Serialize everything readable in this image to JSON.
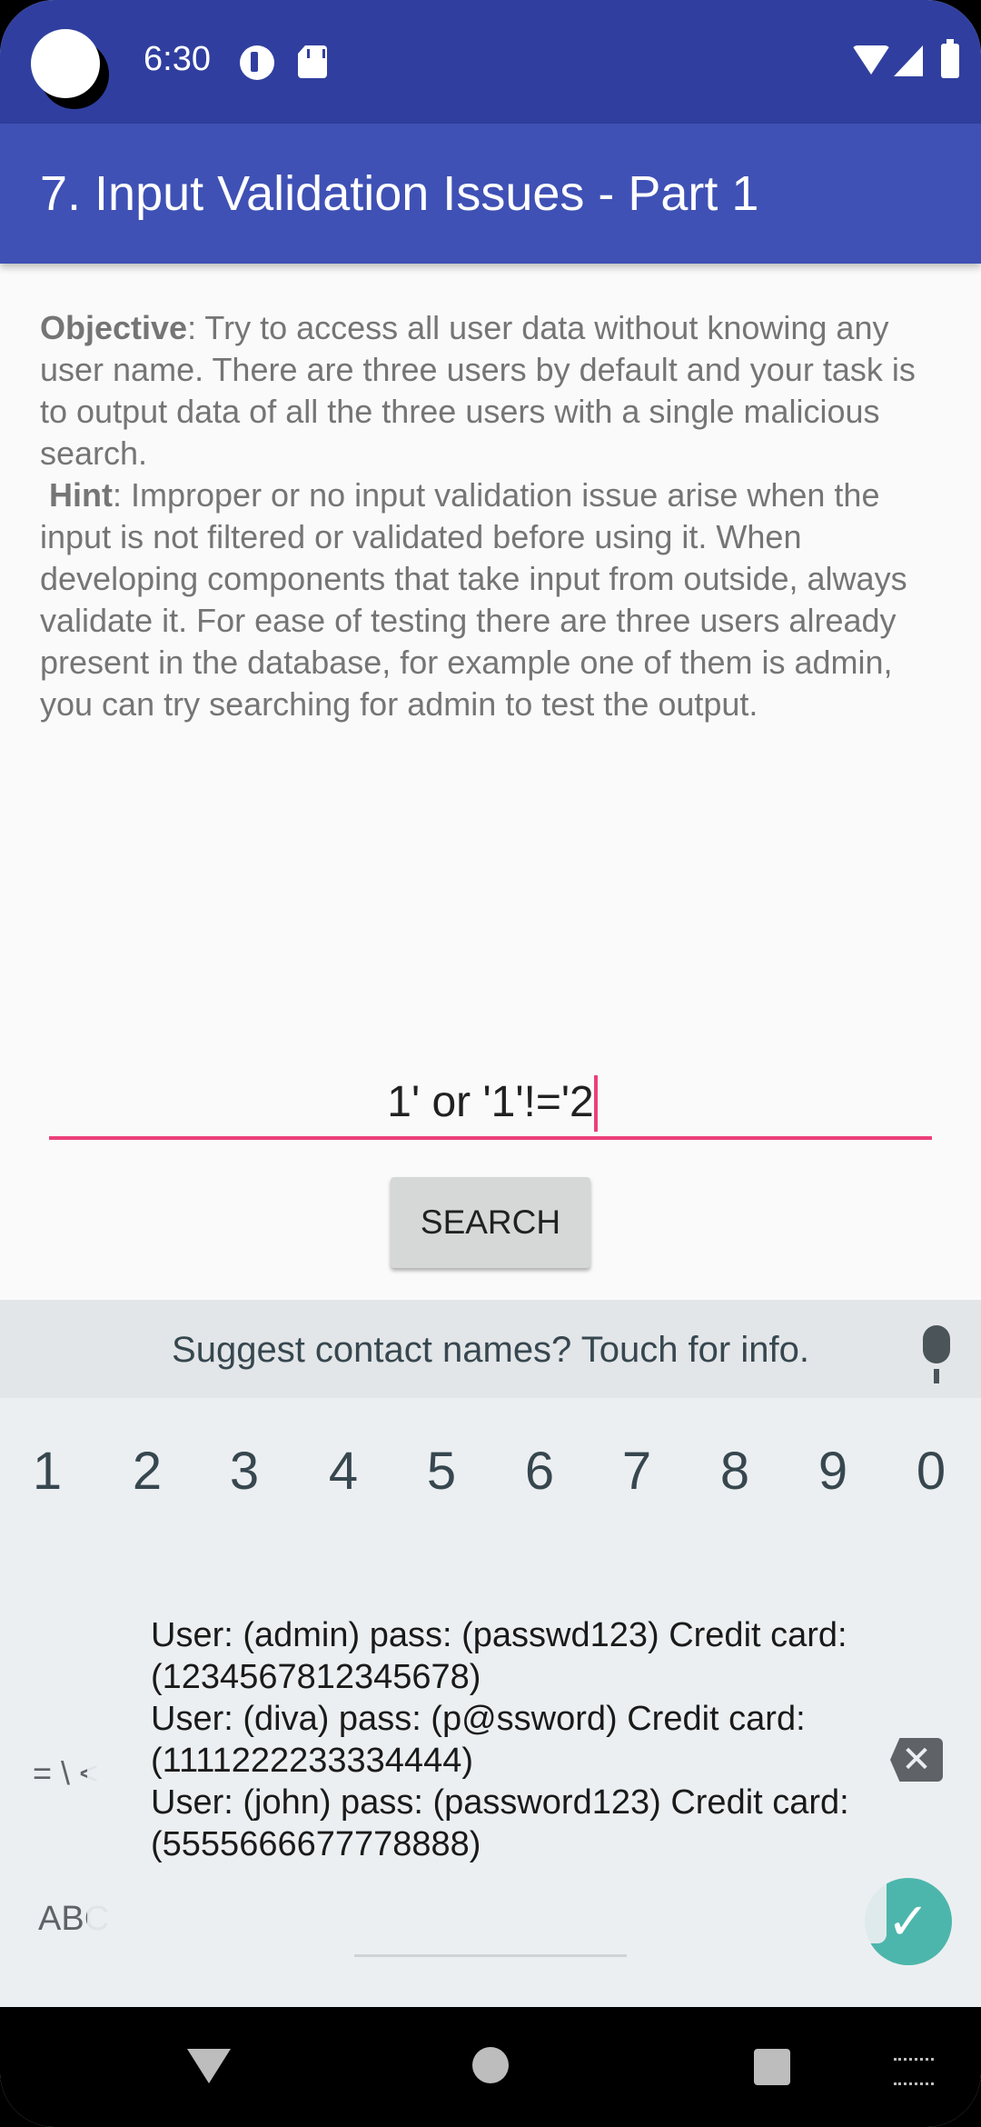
{
  "status_bar": {
    "time": "6:30"
  },
  "app_bar": {
    "title": "7. Input Validation Issues - Part 1"
  },
  "description": {
    "objective_label": "Objective",
    "objective_text": ": Try to access all user data without knowing any user name. There are three users by default and your task is to output data of all the three users with a single malicious search.",
    "hint_label": "Hint",
    "hint_text": ": Improper or no input validation issue arise when the input is not filtered or validated before using it. When developing components that take input from outside, always validate it. For ease of testing there are three users already present in the database, for example one of them is admin, you can try searching for admin to test the output."
  },
  "search": {
    "value": "1' or '1'!='2",
    "button_label": "SEARCH"
  },
  "keyboard": {
    "suggestion": "Suggest contact names? Touch for info.",
    "number_row": [
      "1",
      "2",
      "3",
      "4",
      "5",
      "6",
      "7",
      "8",
      "9",
      "0"
    ],
    "symbols_key": "= \\ <",
    "abc_key": "ABC",
    "backspace_glyph": "✕",
    "done_glyph": "✓"
  },
  "toast": {
    "lines": [
      "User: (admin) pass: (passwd123) Credit card: (1234567812345678)",
      "User: (diva) pass: (p@ssword) Credit card: (1111222233334444)",
      "User: (john) pass: (password123) Credit card: (5555666677778888)"
    ]
  },
  "icons": {
    "status": [
      "notification-icon",
      "sd-card-icon",
      "wifi-icon",
      "signal-icon",
      "battery-icon"
    ],
    "nav": [
      "back-icon",
      "home-icon",
      "recents-icon",
      "keyboard-switch-icon"
    ],
    "accent_color": "#ec407a",
    "app_bar_color": "#3f51b5",
    "status_bar_color": "#303f9f"
  }
}
